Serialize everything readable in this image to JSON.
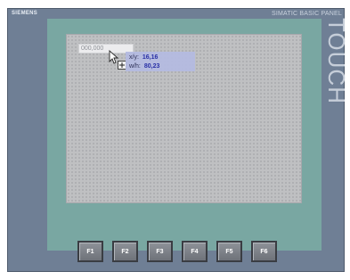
{
  "panel": {
    "brand": "SIEMENS",
    "model": "SIMATIC BASIC PANEL",
    "side_text": "TOUCH"
  },
  "screen": {
    "io_field_value": "000,000",
    "position": {
      "label": "x/y:",
      "value": "16,16"
    },
    "size": {
      "label": "w/h:",
      "value": "80,23"
    }
  },
  "function_keys": [
    {
      "label": "F1"
    },
    {
      "label": "F2"
    },
    {
      "label": "F3"
    },
    {
      "label": "F4"
    },
    {
      "label": "F5"
    },
    {
      "label": "F6"
    }
  ],
  "colors": {
    "housing": "#6f7f95",
    "bezel": "#79a7a2",
    "screen_bg": "#bfc0c2",
    "tooltip_bg": "#b4bbe0",
    "tooltip_text": "#2930a6"
  }
}
